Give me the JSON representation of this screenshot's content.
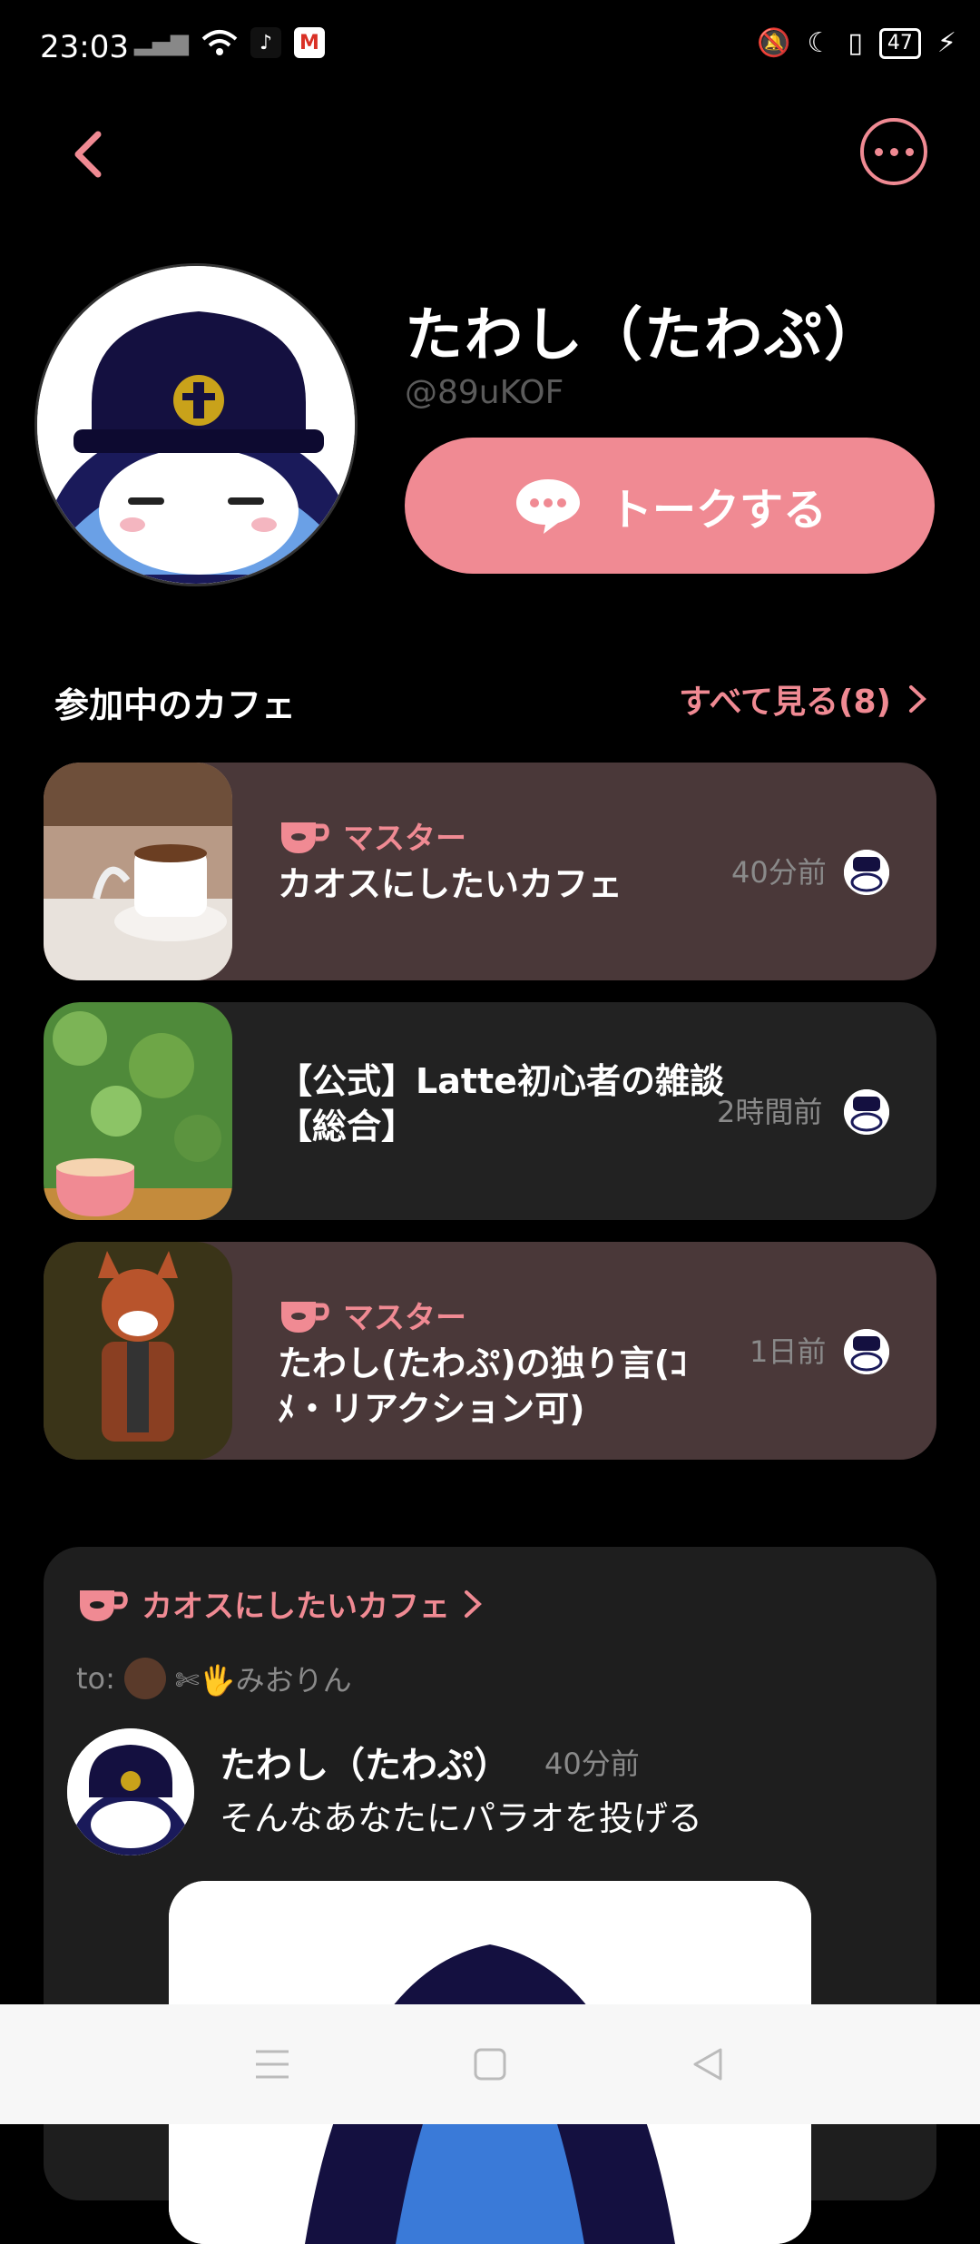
{
  "status_bar": {
    "time": "23:03",
    "battery": "47"
  },
  "header": {
    "back_icon": "chevron-left-icon",
    "more_icon": "more-horizontal-icon"
  },
  "profile": {
    "name": "たわし（たわぷ）",
    "handle": "@89uKOF",
    "talk_button_label": "トークする"
  },
  "cafes_section": {
    "title": "参加中のカフェ",
    "see_all_label": "すべて見る(8)"
  },
  "cafes": [
    {
      "role": "マスター",
      "name": "カオスにしたいカフェ",
      "time": "40分前"
    },
    {
      "role": "",
      "name": "【公式】Latte初心者の雑談【総合】",
      "time": "2時間前"
    },
    {
      "role": "マスター",
      "name": "たわし(たわぷ)の独り言(ｺﾒ・リアクション可)",
      "time": "1日前"
    }
  ],
  "post": {
    "cafe_name": "カオスにしたいカフェ",
    "to_label": "to:",
    "to_name": "✄🖐みおりん",
    "author": "たわし（たわぷ）",
    "time": "40分前",
    "text": "そんなあなたにパラオを投げる"
  },
  "colors": {
    "accent": "#f08a93",
    "background": "#000000",
    "card_master": "#4a3839",
    "card_plain": "#222222"
  }
}
